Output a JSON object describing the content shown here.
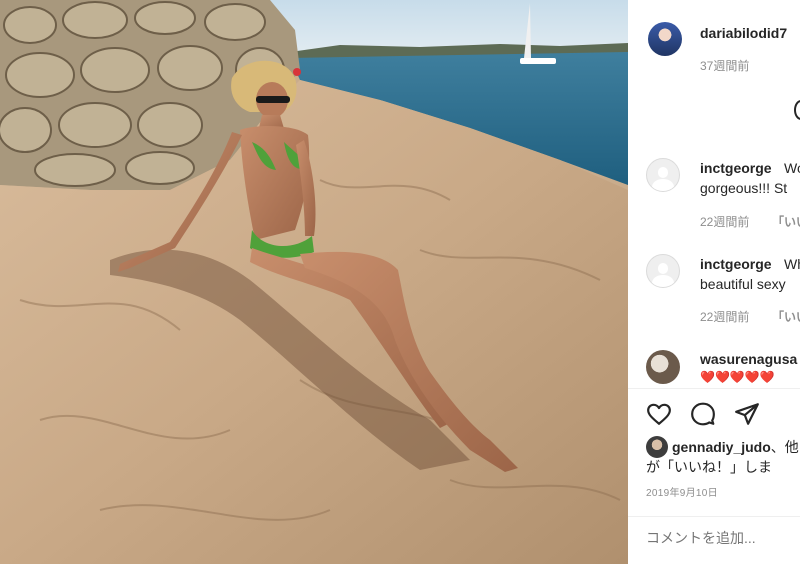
{
  "post": {
    "owner": {
      "username": "dariabilodid7",
      "age": "37週間前"
    },
    "image": {
      "alt": "Woman in a green bikini seated on sunlit rocks by the sea",
      "icon": "photo"
    }
  },
  "comments": [
    {
      "username": "inctgeorge",
      "text_line1": "Wo",
      "text_line2": "gorgeous!!! St",
      "age": "22週間前",
      "reply": "「いい"
    },
    {
      "username": "inctgeorge",
      "text_line1": "Wh",
      "text_line2": "beautiful sexy",
      "age": "22週間前",
      "reply": "「いい"
    },
    {
      "username": "wasurenagusa",
      "text_line1": "❤️❤️❤️❤️❤️",
      "age": "",
      "reply": ""
    }
  ],
  "actions": {
    "like_icon": "heart-outline",
    "comment_icon": "speech-bubble",
    "share_icon": "paper-plane"
  },
  "likes": {
    "liker": "gennadiy_judo",
    "line1_suffix": "、他",
    "line2": "が「いいね！」しま"
  },
  "date": "2019年9月10日",
  "comment_box": {
    "placeholder": "コメントを追加..."
  },
  "colors": {
    "text": "#262626",
    "muted": "#8e8e8e",
    "border": "#efefef",
    "heart": "#ed4956"
  }
}
